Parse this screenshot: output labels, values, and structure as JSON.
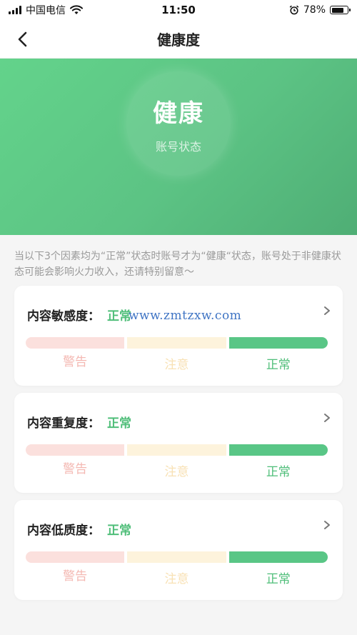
{
  "status_bar": {
    "carrier": "中国电信",
    "time": "11:50",
    "battery_percent": "78%",
    "battery_level": 0.78
  },
  "nav": {
    "title": "健康度",
    "back_icon": "chevron-left-icon"
  },
  "hero": {
    "status": "健康",
    "subtitle": "账号状态",
    "gradient_from": "#63d38b",
    "gradient_to": "#4fae75"
  },
  "note": "当以下3个因素均为“正常”状态时账号才为“健康“状态，账号处于非健康状态可能会影响火力收入，还请特别留意～",
  "level_labels": {
    "warn": "警告",
    "caution": "注意",
    "ok": "正常"
  },
  "colors": {
    "accent_green": "#4fbe79",
    "warn_bar": "#fbe0dd",
    "caution_bar": "#fdf3dc",
    "ok_bar": "#59c686"
  },
  "factors": [
    {
      "label": "内容敏感度：",
      "value": "正常"
    },
    {
      "label": "内容重复度：",
      "value": "正常"
    },
    {
      "label": "内容低质度：",
      "value": "正常"
    }
  ],
  "watermark": "www.zmtzxw.com"
}
